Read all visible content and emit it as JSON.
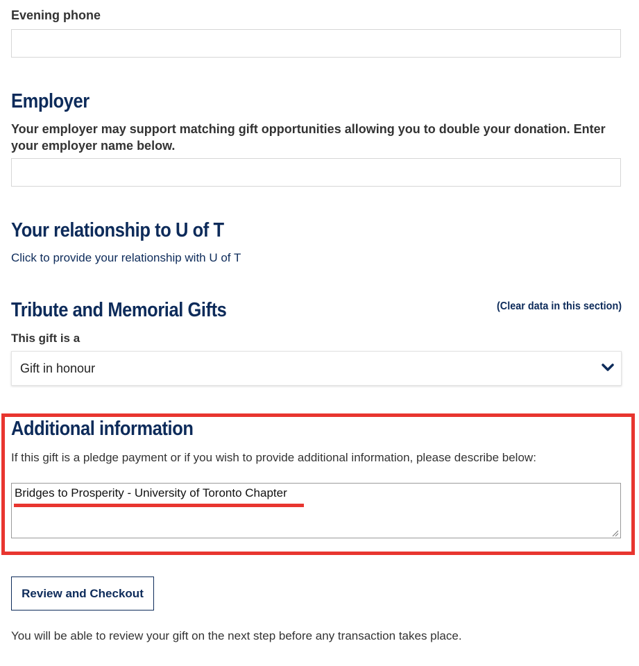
{
  "evening_phone": {
    "label": "Evening phone",
    "value": ""
  },
  "employer": {
    "heading": "Employer",
    "description": "Your employer may support matching gift opportunities allowing you to double your donation. Enter your employer name below.",
    "value": ""
  },
  "relationship": {
    "heading": "Your relationship to U of T",
    "link": "Click to provide your relationship with U of T"
  },
  "tribute": {
    "heading": "Tribute and Memorial Gifts",
    "clear_link": "(Clear data in this section)",
    "gift_label": "This gift is a",
    "gift_selected": "Gift in honour"
  },
  "additional": {
    "heading": "Additional information",
    "description": "If this gift is a pledge payment or if you wish to provide additional information, please describe below:",
    "value": "Bridges to Prosperity - University of Toronto Chapter"
  },
  "checkout": {
    "button_label": "Review and Checkout",
    "note": "You will be able to review your gift on the next step before any transaction takes place."
  },
  "colors": {
    "heading": "#0d2b5a",
    "highlight": "#e8352f"
  },
  "icons": {
    "select_arrow": "chevron-down-icon",
    "resize": "resize-handle-icon"
  }
}
